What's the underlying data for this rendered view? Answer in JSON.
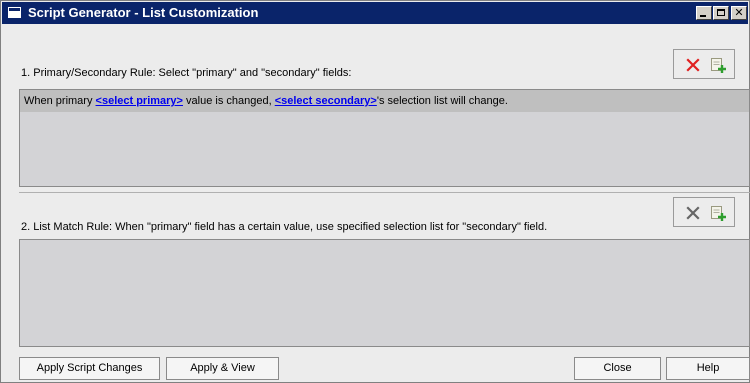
{
  "window": {
    "title": "Script Generator - List Customization"
  },
  "section1": {
    "label": "1. Primary/Secondary Rule: Select \"primary\" and \"secondary\" fields:",
    "rule": {
      "prefix": "When primary ",
      "primary_link": "<select primary>",
      "middle": " value is changed, ",
      "secondary_link": "<select secondary>",
      "suffix": "'s selection list will change."
    }
  },
  "section2": {
    "label": "2. List Match Rule:  When \"primary\" field has a certain value, use specified selection list for \"secondary\" field."
  },
  "buttons": {
    "apply_script_changes": "Apply Script Changes",
    "apply_and_view": "Apply & View",
    "close": "Close",
    "help": "Help"
  },
  "colors": {
    "title_bar": "#0a246a",
    "delete_active": "#e02020",
    "delete_inactive": "#666666",
    "link": "#0000ee"
  }
}
